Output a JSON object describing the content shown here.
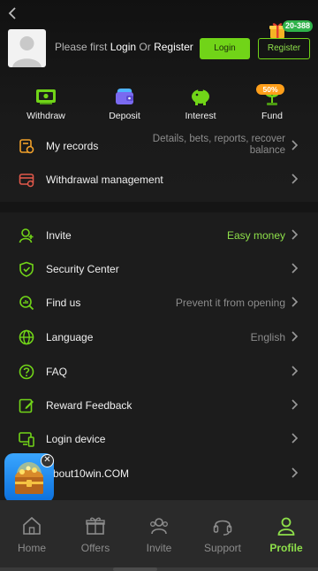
{
  "header": {
    "login_prefix": "Please first ",
    "login_word": "Login",
    "or_word": " Or ",
    "register_word": "Register",
    "login_button": "Login",
    "register_button": "Register",
    "gift_badge": "20-388"
  },
  "quick_actions": [
    {
      "label": "Withdraw",
      "icon": "withdraw-icon"
    },
    {
      "label": "Deposit",
      "icon": "wallet-icon"
    },
    {
      "label": "Interest",
      "icon": "piggy-bank-icon"
    },
    {
      "label": "Fund",
      "icon": "money-plant-icon",
      "badge": "50%"
    }
  ],
  "menu_top": [
    {
      "title": "My records",
      "value_line1": "Details, bets, reports, recover",
      "value_line2": "balance"
    },
    {
      "title": "Withdrawal management",
      "value": ""
    }
  ],
  "menu_main": [
    {
      "title": "Invite",
      "value": "Easy money"
    },
    {
      "title": "Security Center",
      "value": ""
    },
    {
      "title": "Find us",
      "value": "Prevent it from opening"
    },
    {
      "title": "Language",
      "value": "English"
    },
    {
      "title": "FAQ",
      "value": ""
    },
    {
      "title": "Reward Feedback",
      "value": ""
    },
    {
      "title": "Login device",
      "value": ""
    },
    {
      "title": "About10win.COM",
      "value": ""
    }
  ],
  "tabs": [
    {
      "label": "Home"
    },
    {
      "label": "Offers"
    },
    {
      "label": "Invite"
    },
    {
      "label": "Support"
    },
    {
      "label": "Profile",
      "active": true
    }
  ],
  "colors": {
    "accent": "#71d418",
    "fund_badge": "#ff9f1a",
    "records_icon": "#f0a02a",
    "withdraw_mgmt_icon": "#e0584a"
  }
}
